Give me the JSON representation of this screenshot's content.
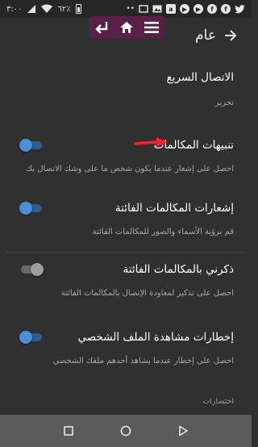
{
  "status_bar": {
    "time": "٣:٠٠",
    "battery_level": "٦٢٪",
    "notification_icons": [
      "twitter-icon",
      "facebook-icon",
      "facebook-icon",
      "youtube-icon",
      "youtube-icon",
      "amazon-icon",
      "image-icon",
      "cast-icon",
      "dots-icon"
    ]
  },
  "app_bar": {
    "title": "عام"
  },
  "settings": [
    {
      "title": "الاتصال السريع",
      "subtitle": "تحرير",
      "toggle": null
    },
    {
      "title": "تنبيهات المكالمات",
      "subtitle": "احصل على إشعار عندما يكون شخص ما على وشك الاتصال بك",
      "toggle": "on"
    },
    {
      "title": "إشعارات المكالمات الفائتة",
      "subtitle": "قم برؤية الأسماء والصور للمكالمات الفائتة",
      "toggle": "on"
    },
    {
      "title": "ذكرني بالمكالمات الفائتة",
      "subtitle": "احصل على تذكير لمعاودة الإتصال بالمكالمات الفائتة",
      "toggle": "off"
    },
    {
      "title": "إخطارات مشاهدة الملف الشخصي",
      "subtitle": "احصل على إخطار عندما يشاهد أحدهم ملفك الشخصي",
      "toggle": "on"
    }
  ],
  "section_footer": "اختصارات",
  "colors": {
    "background": "#303030",
    "toggle_on": "#4b8fd6",
    "toolbox": "#5a1f49",
    "callout_arrow": "#ff1f2f"
  }
}
